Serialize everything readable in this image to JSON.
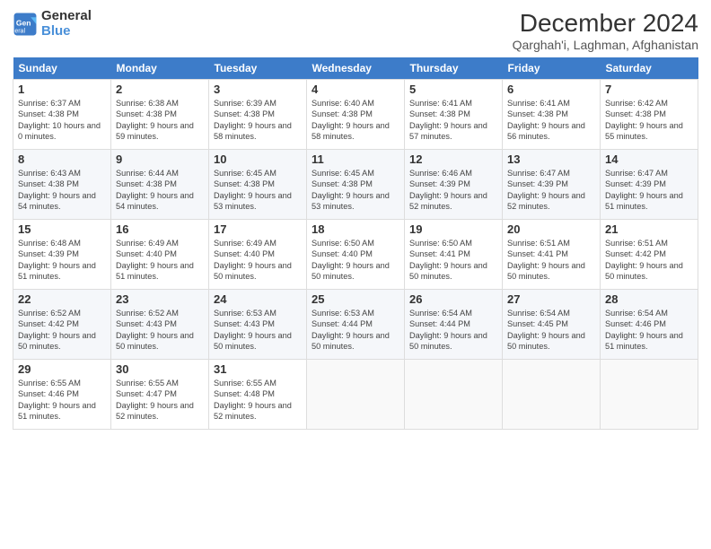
{
  "logo": {
    "line1": "General",
    "line2": "Blue"
  },
  "title": "December 2024",
  "location": "Qarghah'i, Laghman, Afghanistan",
  "days_header": [
    "Sunday",
    "Monday",
    "Tuesday",
    "Wednesday",
    "Thursday",
    "Friday",
    "Saturday"
  ],
  "weeks": [
    [
      {
        "day": "1",
        "sunrise": "6:37 AM",
        "sunset": "4:38 PM",
        "daylight": "10 hours and 0 minutes."
      },
      {
        "day": "2",
        "sunrise": "6:38 AM",
        "sunset": "4:38 PM",
        "daylight": "9 hours and 59 minutes."
      },
      {
        "day": "3",
        "sunrise": "6:39 AM",
        "sunset": "4:38 PM",
        "daylight": "9 hours and 58 minutes."
      },
      {
        "day": "4",
        "sunrise": "6:40 AM",
        "sunset": "4:38 PM",
        "daylight": "9 hours and 58 minutes."
      },
      {
        "day": "5",
        "sunrise": "6:41 AM",
        "sunset": "4:38 PM",
        "daylight": "9 hours and 57 minutes."
      },
      {
        "day": "6",
        "sunrise": "6:41 AM",
        "sunset": "4:38 PM",
        "daylight": "9 hours and 56 minutes."
      },
      {
        "day": "7",
        "sunrise": "6:42 AM",
        "sunset": "4:38 PM",
        "daylight": "9 hours and 55 minutes."
      }
    ],
    [
      {
        "day": "8",
        "sunrise": "6:43 AM",
        "sunset": "4:38 PM",
        "daylight": "9 hours and 54 minutes."
      },
      {
        "day": "9",
        "sunrise": "6:44 AM",
        "sunset": "4:38 PM",
        "daylight": "9 hours and 54 minutes."
      },
      {
        "day": "10",
        "sunrise": "6:45 AM",
        "sunset": "4:38 PM",
        "daylight": "9 hours and 53 minutes."
      },
      {
        "day": "11",
        "sunrise": "6:45 AM",
        "sunset": "4:38 PM",
        "daylight": "9 hours and 53 minutes."
      },
      {
        "day": "12",
        "sunrise": "6:46 AM",
        "sunset": "4:39 PM",
        "daylight": "9 hours and 52 minutes."
      },
      {
        "day": "13",
        "sunrise": "6:47 AM",
        "sunset": "4:39 PM",
        "daylight": "9 hours and 52 minutes."
      },
      {
        "day": "14",
        "sunrise": "6:47 AM",
        "sunset": "4:39 PM",
        "daylight": "9 hours and 51 minutes."
      }
    ],
    [
      {
        "day": "15",
        "sunrise": "6:48 AM",
        "sunset": "4:39 PM",
        "daylight": "9 hours and 51 minutes."
      },
      {
        "day": "16",
        "sunrise": "6:49 AM",
        "sunset": "4:40 PM",
        "daylight": "9 hours and 51 minutes."
      },
      {
        "day": "17",
        "sunrise": "6:49 AM",
        "sunset": "4:40 PM",
        "daylight": "9 hours and 50 minutes."
      },
      {
        "day": "18",
        "sunrise": "6:50 AM",
        "sunset": "4:40 PM",
        "daylight": "9 hours and 50 minutes."
      },
      {
        "day": "19",
        "sunrise": "6:50 AM",
        "sunset": "4:41 PM",
        "daylight": "9 hours and 50 minutes."
      },
      {
        "day": "20",
        "sunrise": "6:51 AM",
        "sunset": "4:41 PM",
        "daylight": "9 hours and 50 minutes."
      },
      {
        "day": "21",
        "sunrise": "6:51 AM",
        "sunset": "4:42 PM",
        "daylight": "9 hours and 50 minutes."
      }
    ],
    [
      {
        "day": "22",
        "sunrise": "6:52 AM",
        "sunset": "4:42 PM",
        "daylight": "9 hours and 50 minutes."
      },
      {
        "day": "23",
        "sunrise": "6:52 AM",
        "sunset": "4:43 PM",
        "daylight": "9 hours and 50 minutes."
      },
      {
        "day": "24",
        "sunrise": "6:53 AM",
        "sunset": "4:43 PM",
        "daylight": "9 hours and 50 minutes."
      },
      {
        "day": "25",
        "sunrise": "6:53 AM",
        "sunset": "4:44 PM",
        "daylight": "9 hours and 50 minutes."
      },
      {
        "day": "26",
        "sunrise": "6:54 AM",
        "sunset": "4:44 PM",
        "daylight": "9 hours and 50 minutes."
      },
      {
        "day": "27",
        "sunrise": "6:54 AM",
        "sunset": "4:45 PM",
        "daylight": "9 hours and 50 minutes."
      },
      {
        "day": "28",
        "sunrise": "6:54 AM",
        "sunset": "4:46 PM",
        "daylight": "9 hours and 51 minutes."
      }
    ],
    [
      {
        "day": "29",
        "sunrise": "6:55 AM",
        "sunset": "4:46 PM",
        "daylight": "9 hours and 51 minutes."
      },
      {
        "day": "30",
        "sunrise": "6:55 AM",
        "sunset": "4:47 PM",
        "daylight": "9 hours and 52 minutes."
      },
      {
        "day": "31",
        "sunrise": "6:55 AM",
        "sunset": "4:48 PM",
        "daylight": "9 hours and 52 minutes."
      },
      null,
      null,
      null,
      null
    ]
  ]
}
